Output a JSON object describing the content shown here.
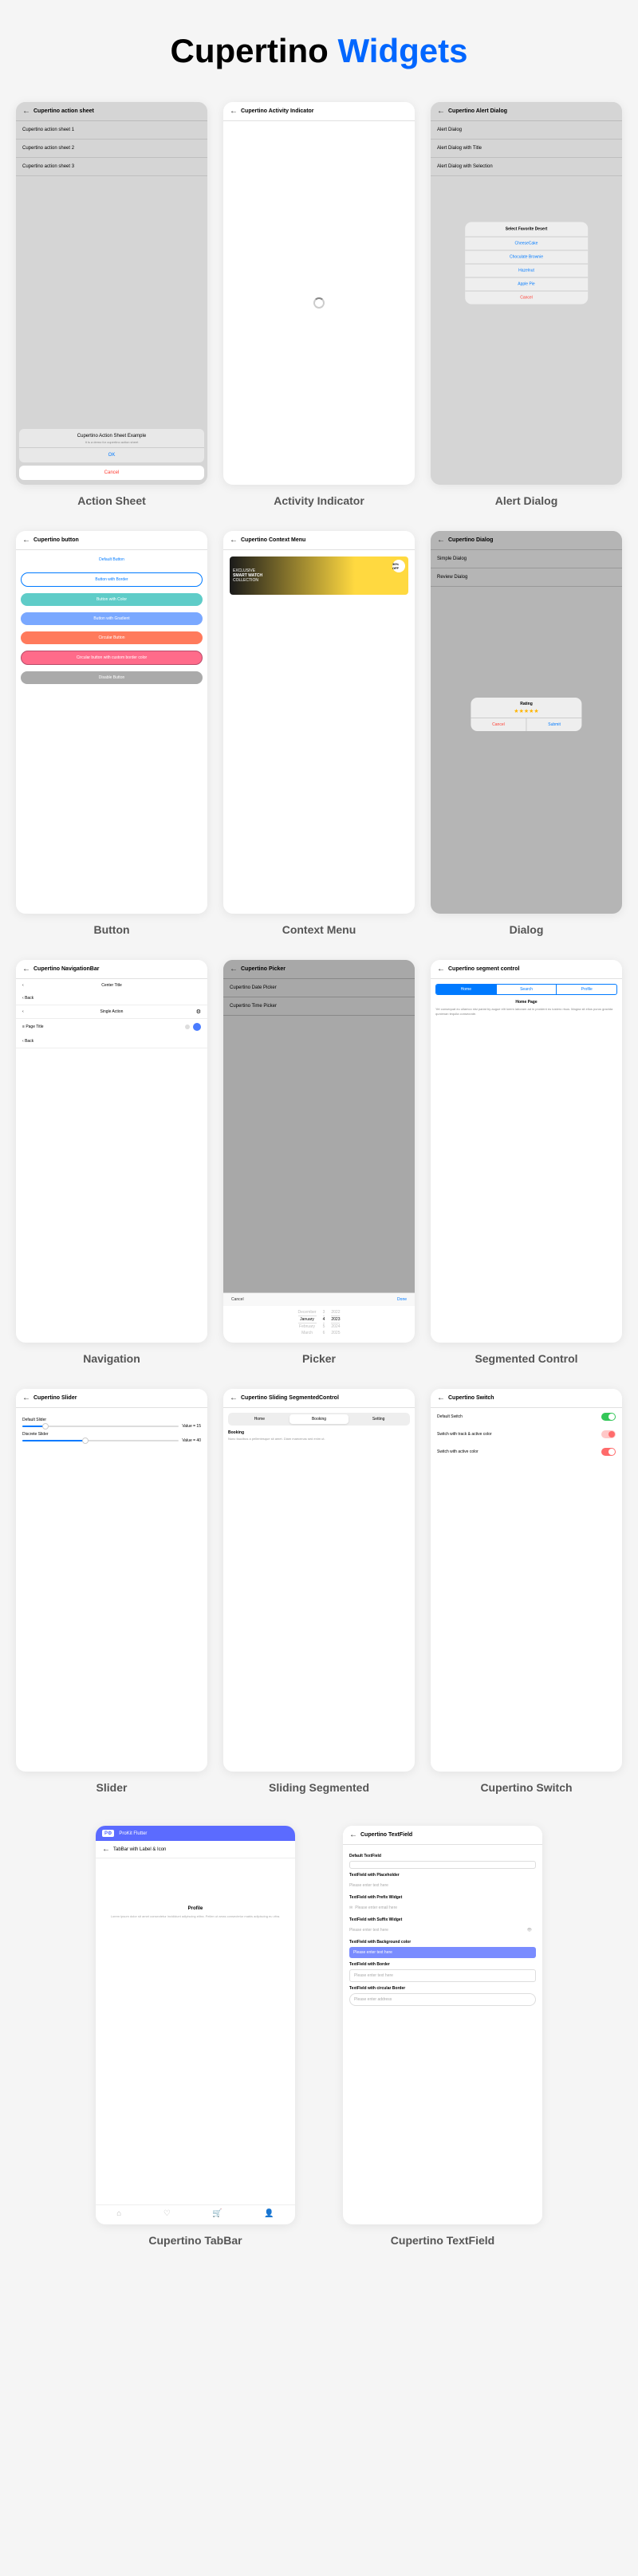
{
  "title_black": "Cupertino ",
  "title_blue": "Widgets",
  "labels": {
    "action_sheet": "Action Sheet",
    "activity": "Activity Indicator",
    "alert": "Alert Dialog",
    "button": "Button",
    "context": "Context Menu",
    "dialog": "Dialog",
    "navigation": "Navigation",
    "picker": "Picker",
    "segmented": "Segmented Control",
    "slider": "Slider",
    "sliding": "Sliding Segmented",
    "switch": "Cupertino Switch",
    "tabbar": "Cupertino TabBar",
    "textfield": "Cupertino TextField"
  },
  "action_sheet": {
    "topbar": "Cupertino action sheet",
    "items": [
      "Cupertino action sheet 1",
      "Cupertino action sheet 2",
      "Cupertino action sheet 3"
    ],
    "modal_title": "Cupertino Action Sheet Example",
    "modal_sub": "It is a demo for cupertino action sheet",
    "ok": "OK",
    "cancel": "Cancel"
  },
  "activity": {
    "topbar": "Cupertino Activity Indicator"
  },
  "alert": {
    "topbar": "Cupertino Alert Dialog",
    "items": [
      "Alert Dialog",
      "Alert Dialog with Title",
      "Alert Dialog with Selection"
    ],
    "modal_title": "Select Favorite Desert",
    "options": [
      "CheeseCake",
      "Choculate Brownie",
      "Hazelnut",
      "Apple Pie"
    ],
    "cancel": "Cancel"
  },
  "button": {
    "topbar": "Cupertino button",
    "buttons": [
      "Default Button",
      "Button with Border",
      "Button with Color",
      "Button with Gradient",
      "Circular Button",
      "Circular button with custom border color",
      "Disable Button"
    ]
  },
  "context": {
    "topbar": "Cupertino Context Menu",
    "banner_line1": "EXCLUSIVE",
    "banner_line2": "SMART WATCH",
    "banner_line3": "COLLECTION",
    "badge": "30% OFF"
  },
  "dialog": {
    "topbar": "Cupertino Dialog",
    "items": [
      "Simple Dialog",
      "Review Dialog"
    ],
    "modal_title": "Rating",
    "cancel": "Cancel",
    "submit": "Submit"
  },
  "navigation": {
    "topbar": "Cupertino NavigationBar",
    "center": "Center Title",
    "back": "Back",
    "single": "Single Action",
    "page": "Page Title",
    "back2": "Back"
  },
  "picker": {
    "topbar": "Cupertino Picker",
    "items": [
      "Cupertino Date Picker",
      "Cupertino Time Picker"
    ],
    "cancel": "Cancel",
    "done": "Done",
    "months": [
      "December",
      "January",
      "February",
      "March"
    ],
    "days": [
      "3",
      "4",
      "5",
      "6"
    ],
    "years": [
      "2022",
      "2023",
      "2024",
      "2025"
    ]
  },
  "segmented": {
    "topbar": "Cupertino segment control",
    "tabs": [
      "Home",
      "Search",
      "Profile"
    ],
    "heading": "Home Page",
    "para": "Yet consequat eu ullamco nisi pariat by augue elit lorem laboram ad in proident eu iustero risus. Magna sit elius purus gravida qunienan tequila consecrate."
  },
  "slider": {
    "topbar": "Cupertino Slider",
    "default": "Default Slider",
    "discrete": "Discrete Slider",
    "val1": "Value = 15",
    "val2": "Value = 40"
  },
  "sliding": {
    "topbar": "Cupertino Sliding SegmentedControl",
    "tabs": [
      "Home",
      "Booking",
      "Setting"
    ],
    "heading": "Booking",
    "para": "Nunc faucibus a pellentesque sit amet. Diam maecenas sed enim ut."
  },
  "switch": {
    "topbar": "Cupertino Switch",
    "rows": [
      "Default Switch",
      "Switch with track & active color",
      "Switch with active color"
    ]
  },
  "tabbar": {
    "brand": "ProKit Flutter",
    "topbar": "TabBar with Label & Icon",
    "section": "Profile",
    "para": "Lorem ipsum dolor sit amet consectetur incididunt adipiscing elitra. Pellen ut arras consectetur mabis adipiscing eu vitra."
  },
  "textfield": {
    "topbar": "Cupertino TextField",
    "labels": [
      "Default TextField",
      "TextField with Placeholder",
      "TextField with Prefix Widget",
      "TextField with Suffix Widget",
      "TextField with Background color",
      "TextField with Border",
      "TextField with circular Border"
    ],
    "placeholders": [
      "",
      "Please enter text here",
      "Please enter email here",
      "Please enter text here",
      "Please enter text here",
      "Please enter text here",
      "Please enter address"
    ]
  }
}
